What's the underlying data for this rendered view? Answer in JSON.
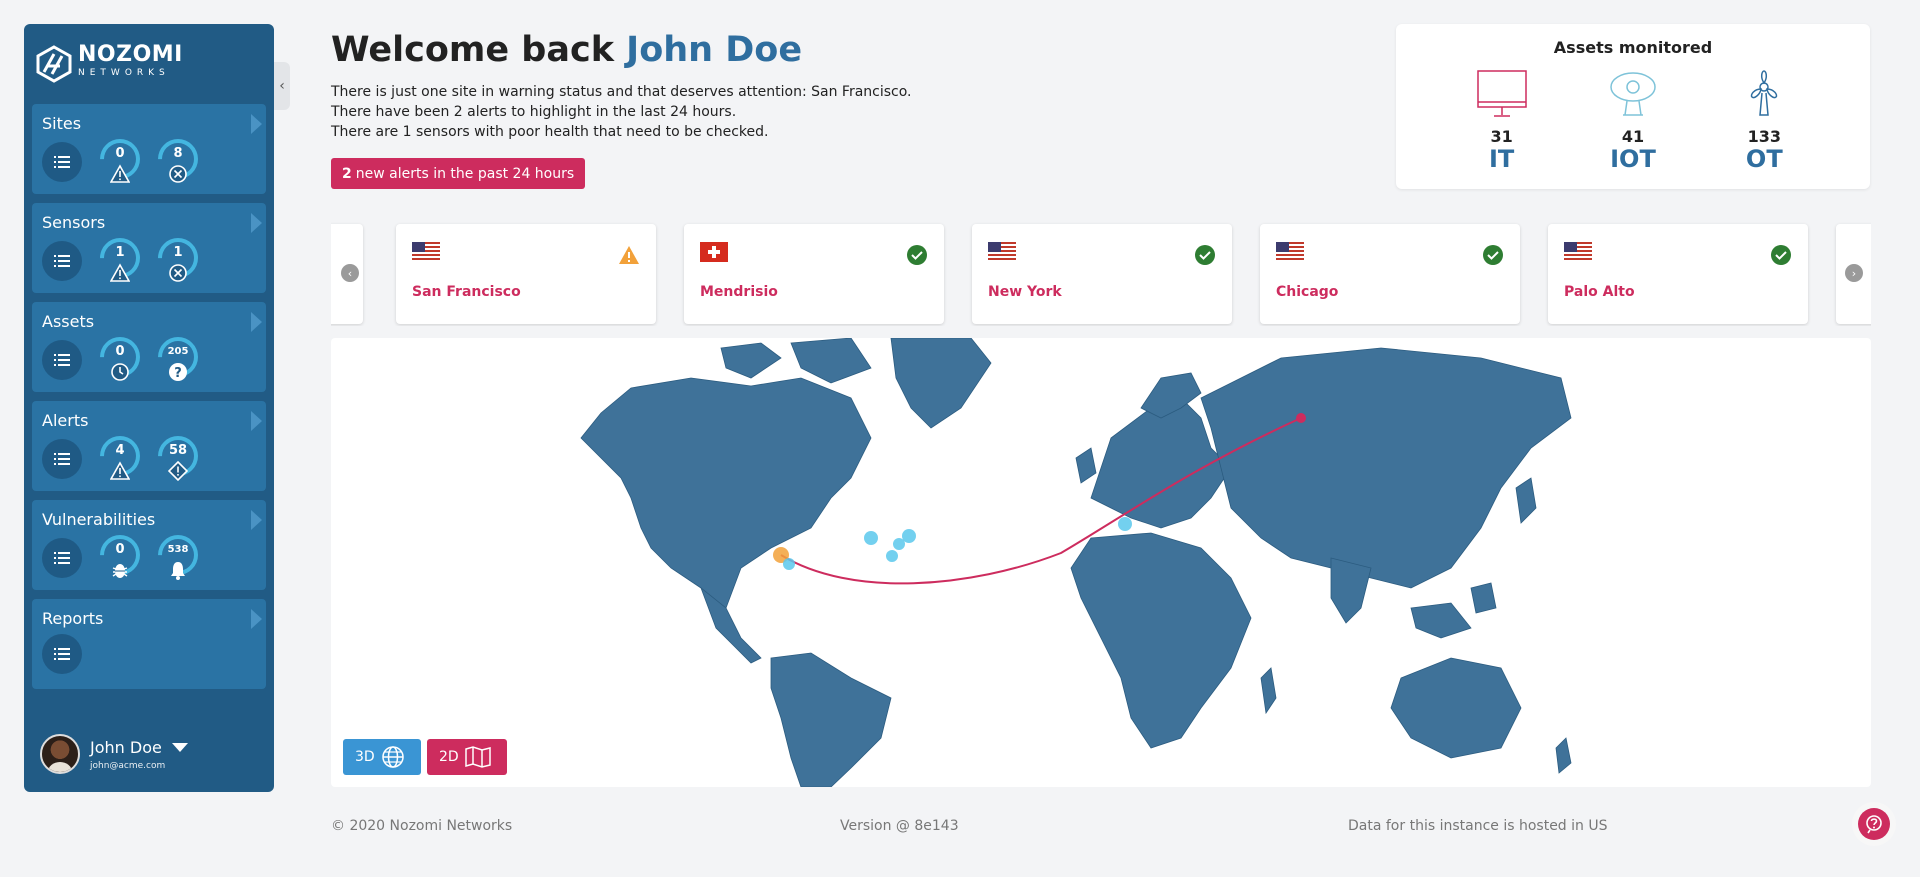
{
  "sidebar": {
    "logo": {
      "name": "NOZOMI",
      "sub": "NETWORKS"
    },
    "cards": [
      {
        "title": "Sites",
        "g1": "0",
        "g1_icon": "warning-icon",
        "g2": "8",
        "g2_icon": "error-icon"
      },
      {
        "title": "Sensors",
        "g1": "1",
        "g1_icon": "warning-icon",
        "g2": "1",
        "g2_icon": "error-icon"
      },
      {
        "title": "Assets",
        "g1": "0",
        "g1_icon": "clock-icon",
        "g2": "205",
        "g2_icon": "question-icon"
      },
      {
        "title": "Alerts",
        "g1": "4",
        "g1_icon": "warning-icon",
        "g2": "58",
        "g2_icon": "diamond-warning-icon"
      },
      {
        "title": "Vulnerabilities",
        "g1": "0",
        "g1_icon": "bug-icon",
        "g2": "538",
        "g2_icon": "bell-icon"
      },
      {
        "title": "Reports"
      }
    ],
    "user": {
      "name": "John Doe",
      "email": "john@acme.com"
    }
  },
  "header": {
    "welcome_prefix": "Welcome back",
    "user_name": "John Doe",
    "messages": [
      "There is just one site in warning status and that deserves attention: San Francisco.",
      "There have been 2 alerts to highlight in the last 24 hours.",
      "There are 1 sensors with poor health that need to be checked."
    ],
    "alert_count": "2",
    "alert_text": "new alerts in the past 24 hours"
  },
  "assets": {
    "title": "Assets monitored",
    "items": [
      {
        "count": "31",
        "label": "IT",
        "icon": "monitor-icon"
      },
      {
        "count": "41",
        "label": "IOT",
        "icon": "camera-icon"
      },
      {
        "count": "133",
        "label": "OT",
        "icon": "wind-turbine-icon"
      }
    ]
  },
  "sites": [
    {
      "name": "San Francisco",
      "flag": "us-flag-icon",
      "status": "warning"
    },
    {
      "name": "Mendrisio",
      "flag": "ch-flag-icon",
      "status": "ok"
    },
    {
      "name": "New York",
      "flag": "us-flag-icon",
      "status": "ok"
    },
    {
      "name": "Chicago",
      "flag": "us-flag-icon",
      "status": "ok"
    },
    {
      "name": "Palo Alto",
      "flag": "us-flag-icon",
      "status": "ok"
    }
  ],
  "map": {
    "btn_3d": "3D",
    "btn_2d": "2D"
  },
  "footer": {
    "copyright": "© 2020 Nozomi Networks",
    "version": "Version @ 8e143",
    "hosted": "Data for this instance is hosted in US"
  },
  "colors": {
    "primary": "#215b85",
    "accent": "#cd2c5e",
    "link": "#2f6e9f",
    "ok": "#2e7d32",
    "warning": "#f2a13a"
  }
}
